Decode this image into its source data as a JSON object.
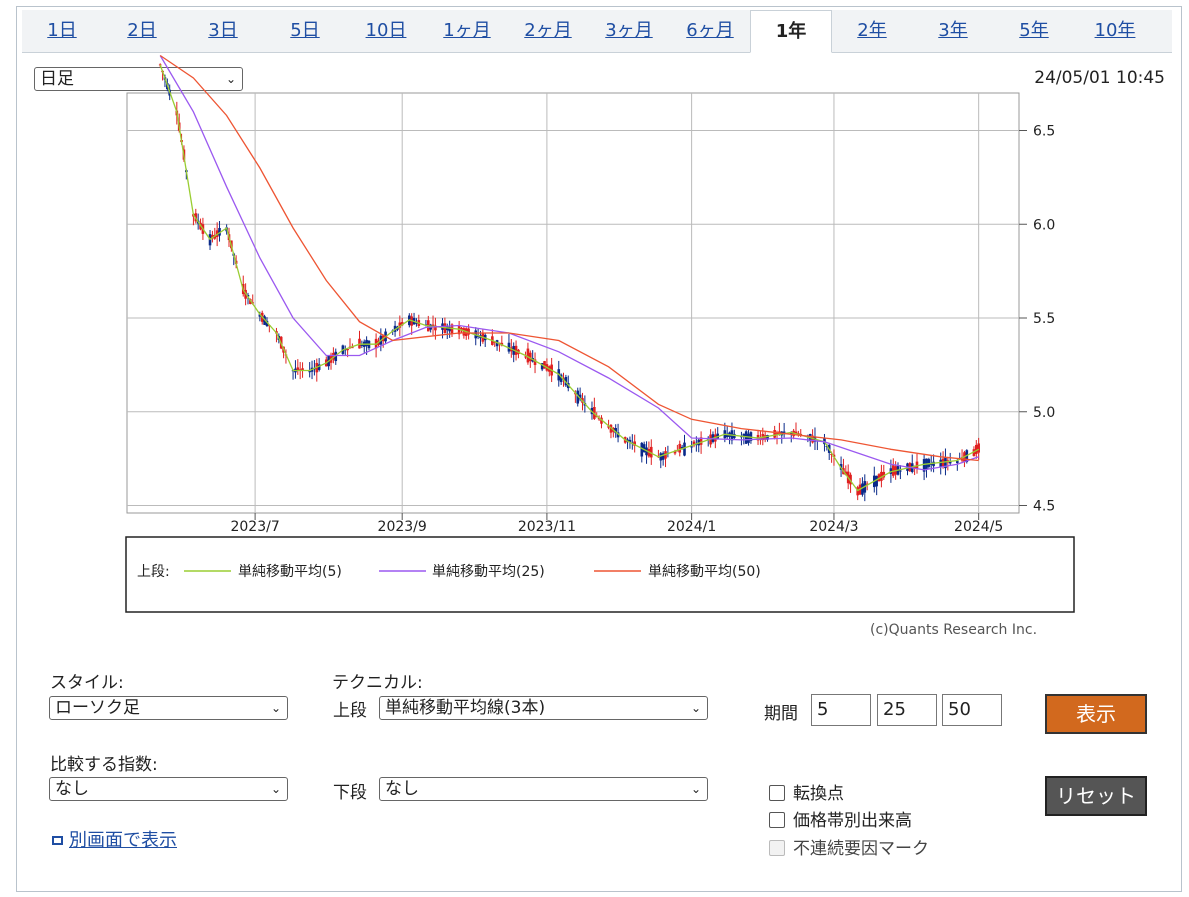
{
  "tabs": [
    {
      "label": "1日",
      "active": false
    },
    {
      "label": "2日",
      "active": false
    },
    {
      "label": "3日",
      "active": false
    },
    {
      "label": "5日",
      "active": false
    },
    {
      "label": "10日",
      "active": false
    },
    {
      "label": "1ヶ月",
      "active": false
    },
    {
      "label": "2ヶ月",
      "active": false
    },
    {
      "label": "3ヶ月",
      "active": false
    },
    {
      "label": "6ヶ月",
      "active": false
    },
    {
      "label": "1年",
      "active": true
    },
    {
      "label": "2年",
      "active": false
    },
    {
      "label": "3年",
      "active": false
    },
    {
      "label": "5年",
      "active": false
    },
    {
      "label": "10年",
      "active": false
    }
  ],
  "interval_select": "日足",
  "datetime": "24/05/01 10:45",
  "legend": {
    "prefix": "上段:",
    "items": [
      {
        "label": "単純移動平均(5)",
        "color": "#9acd32"
      },
      {
        "label": "単純移動平均(25)",
        "color": "#9b59f0"
      },
      {
        "label": "単純移動平均(50)",
        "color": "#ee5533"
      }
    ]
  },
  "copyright": "(c)Quants Research Inc.",
  "controls": {
    "style_label": "スタイル:",
    "style_value": "ローソク足",
    "technical_label": "テクニカル:",
    "upper_label": "上段",
    "upper_value": "単純移動平均線(3本)",
    "lower_label": "下段",
    "lower_value": "なし",
    "compare_label": "比較する指数:",
    "compare_value": "なし",
    "period_label": "期間",
    "periods": [
      "5",
      "25",
      "50"
    ],
    "show_button": "表示",
    "reset_button": "リセット",
    "checkboxes": [
      {
        "label": "転換点",
        "checked": false,
        "disabled": false
      },
      {
        "label": "価格帯別出来高",
        "checked": false,
        "disabled": false
      },
      {
        "label": "不連続要因マーク",
        "checked": false,
        "disabled": true
      }
    ],
    "new_window_link": "別画面で表示"
  },
  "colors": {
    "up": "#e02020",
    "down": "#0a2a8a",
    "show_button": "#d2691e",
    "reset_button": "#555555"
  },
  "chart_data": {
    "type": "line",
    "x_tick_labels": [
      "2023/7",
      "2023/9",
      "2023/11",
      "2024/1",
      "2024/3",
      "2024/5"
    ],
    "y_ticks": [
      4.5,
      5.0,
      5.5,
      6.0,
      6.5
    ],
    "ylim": [
      4.46,
      6.7
    ],
    "grid": true,
    "legend_position": "below",
    "series": [
      {
        "name": "単純移動平均(5)",
        "x": [
          "2023/05/22",
          "2023/05/29",
          "2023/06/05",
          "2023/06/12",
          "2023/06/19",
          "2023/06/26",
          "2023/07/03",
          "2023/07/10",
          "2023/07/17",
          "2023/07/24",
          "2023/07/31",
          "2023/08/07",
          "2023/08/14",
          "2023/08/21",
          "2023/08/28",
          "2023/09/04",
          "2023/09/11",
          "2023/09/25",
          "2023/10/09",
          "2023/10/23",
          "2023/11/06",
          "2023/11/20",
          "2023/12/04",
          "2023/12/18",
          "2024/01/01",
          "2024/01/15",
          "2024/01/29",
          "2024/02/12",
          "2024/02/26",
          "2024/03/04",
          "2024/03/11",
          "2024/03/25",
          "2024/04/08",
          "2024/04/22",
          "2024/05/01"
        ],
        "values": [
          6.85,
          6.6,
          6.05,
          5.92,
          5.98,
          5.65,
          5.52,
          5.42,
          5.22,
          5.22,
          5.26,
          5.33,
          5.36,
          5.36,
          5.43,
          5.49,
          5.46,
          5.44,
          5.38,
          5.3,
          5.2,
          5.0,
          4.85,
          4.76,
          4.82,
          4.88,
          4.86,
          4.89,
          4.84,
          4.7,
          4.58,
          4.68,
          4.72,
          4.74,
          4.8
        ]
      },
      {
        "name": "単純移動平均(25)",
        "x": [
          "2023/05/22",
          "2023/06/05",
          "2023/06/19",
          "2023/07/03",
          "2023/07/17",
          "2023/07/31",
          "2023/08/14",
          "2023/08/28",
          "2023/09/11",
          "2023/09/25",
          "2023/10/16",
          "2023/11/06",
          "2023/11/27",
          "2023/12/18",
          "2024/01/01",
          "2024/01/22",
          "2024/02/12",
          "2024/02/26",
          "2024/03/11",
          "2024/03/25",
          "2024/04/08",
          "2024/04/22",
          "2024/05/01"
        ],
        "values": [
          6.9,
          6.6,
          6.2,
          5.82,
          5.5,
          5.3,
          5.3,
          5.38,
          5.45,
          5.46,
          5.42,
          5.32,
          5.18,
          5.02,
          4.86,
          4.85,
          4.86,
          4.84,
          4.78,
          4.72,
          4.69,
          4.72,
          4.76
        ]
      },
      {
        "name": "単純移動平均(50)",
        "x": [
          "2023/05/22",
          "2023/06/05",
          "2023/06/19",
          "2023/07/03",
          "2023/07/17",
          "2023/07/31",
          "2023/08/14",
          "2023/08/28",
          "2023/09/11",
          "2023/09/25",
          "2023/10/16",
          "2023/11/06",
          "2023/11/27",
          "2023/12/18",
          "2024/01/01",
          "2024/01/22",
          "2024/02/12",
          "2024/03/04",
          "2024/03/25",
          "2024/04/15",
          "2024/05/01"
        ],
        "values": [
          6.9,
          6.78,
          6.58,
          6.3,
          5.98,
          5.7,
          5.48,
          5.38,
          5.4,
          5.42,
          5.42,
          5.38,
          5.24,
          5.04,
          4.96,
          4.91,
          4.88,
          4.85,
          4.8,
          4.76,
          4.74
        ]
      }
    ]
  }
}
